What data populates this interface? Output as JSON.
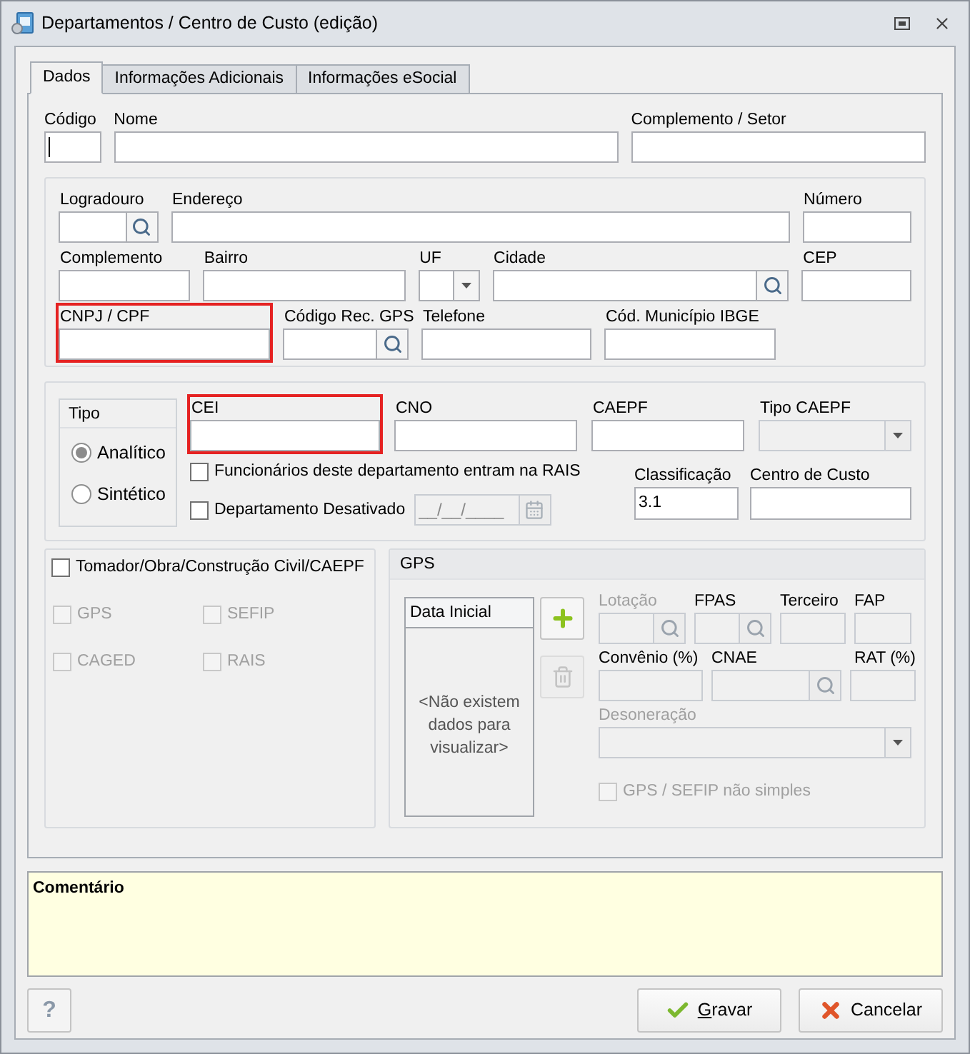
{
  "window": {
    "title": "Departamentos / Centro de Custo (edição)"
  },
  "tabs": [
    {
      "label": "Dados",
      "selected": true
    },
    {
      "label": "Informações Adicionais",
      "selected": false
    },
    {
      "label": "Informações eSocial",
      "selected": false
    }
  ],
  "top_fields": [
    {
      "label": "Código",
      "focused": true
    },
    {
      "label": "Nome",
      "focused": false
    },
    {
      "label": "Complemento / Setor",
      "focused": false
    }
  ],
  "address_rows": [
    [
      {
        "label": "Logradouro",
        "kind": "search",
        "highlighted": false
      },
      {
        "label": "Endereço",
        "kind": "text",
        "highlighted": false
      },
      {
        "label": "Número",
        "kind": "text",
        "highlighted": false
      }
    ],
    [
      {
        "label": "Complemento",
        "kind": "text",
        "highlighted": false
      },
      {
        "label": "Bairro",
        "kind": "text",
        "highlighted": false
      },
      {
        "label": "UF",
        "kind": "select",
        "highlighted": false
      },
      {
        "label": "Cidade",
        "kind": "search",
        "highlighted": false
      },
      {
        "label": "CEP",
        "kind": "text",
        "highlighted": false
      }
    ],
    [
      {
        "label": "CNPJ / CPF",
        "kind": "text",
        "highlighted": true
      },
      {
        "label": "Código Rec. GPS",
        "kind": "search",
        "highlighted": false
      },
      {
        "label": "Telefone",
        "kind": "text",
        "highlighted": false
      },
      {
        "label": "Cód. Município IBGE",
        "kind": "text",
        "highlighted": false
      }
    ]
  ],
  "tipo": {
    "title": "Tipo",
    "options": [
      {
        "label": "Analítico",
        "selected": true
      },
      {
        "label": "Sintético",
        "selected": false
      }
    ]
  },
  "id_fields": [
    {
      "label": "CEI",
      "kind": "text",
      "highlighted": true,
      "disabled": false
    },
    {
      "label": "CNO",
      "kind": "text",
      "highlighted": false,
      "disabled": false
    },
    {
      "label": "CAEPF",
      "kind": "text",
      "highlighted": false,
      "disabled": false
    },
    {
      "label": "Tipo CAEPF",
      "kind": "select",
      "highlighted": false,
      "disabled": true
    }
  ],
  "flags": [
    {
      "label": "Funcionários deste departamento entram na RAIS",
      "checked": false
    },
    {
      "label": "Departamento Desativado",
      "checked": false
    }
  ],
  "inactive_date": {
    "placeholder": "__/__/____",
    "disabled": true
  },
  "class_fields": [
    {
      "label": "Classificação",
      "value": "3.1"
    },
    {
      "label": "Centro de Custo"
    }
  ],
  "tomador": {
    "label": "Tomador/Obra/Construção Civil/CAEPF",
    "checked": false,
    "options": [
      {
        "label": "GPS",
        "checked": false,
        "disabled": true
      },
      {
        "label": "SEFIP",
        "checked": false,
        "disabled": true
      },
      {
        "label": "CAGED",
        "checked": false,
        "disabled": true
      },
      {
        "label": "RAIS",
        "checked": false,
        "disabled": true
      }
    ]
  },
  "gps": {
    "title": "GPS",
    "list_column": "Data Inicial",
    "empty_text": "<Não existem dados para visualizar>",
    "buttons": [
      {
        "kind": "add",
        "disabled": false
      },
      {
        "kind": "delete",
        "disabled": true
      }
    ],
    "field_rows": [
      [
        {
          "label": "Lotação",
          "kind": "search",
          "dimmed": true
        },
        {
          "label": "FPAS",
          "kind": "search",
          "dimmed": false
        },
        {
          "label": "Terceiro",
          "kind": "text",
          "dimmed": false
        },
        {
          "label": "FAP",
          "kind": "text",
          "dimmed": false
        }
      ],
      [
        {
          "label": "Convênio (%)",
          "kind": "text",
          "dimmed": false
        },
        {
          "label": "CNAE",
          "kind": "search",
          "dimmed": false
        },
        {
          "label": "RAT (%)",
          "kind": "text",
          "dimmed": false
        }
      ],
      [
        {
          "label": "Desoneração",
          "kind": "select",
          "dimmed": true
        }
      ]
    ],
    "simple_check": {
      "label": "GPS / SEFIP não simples",
      "checked": false,
      "disabled": true
    }
  },
  "comment": {
    "label": "Comentário"
  },
  "help": "?",
  "buttons": [
    {
      "kind": "save",
      "label": "Gravar",
      "underline_first": true
    },
    {
      "kind": "cancel",
      "label": "Cancelar",
      "underline_first": false
    }
  ]
}
